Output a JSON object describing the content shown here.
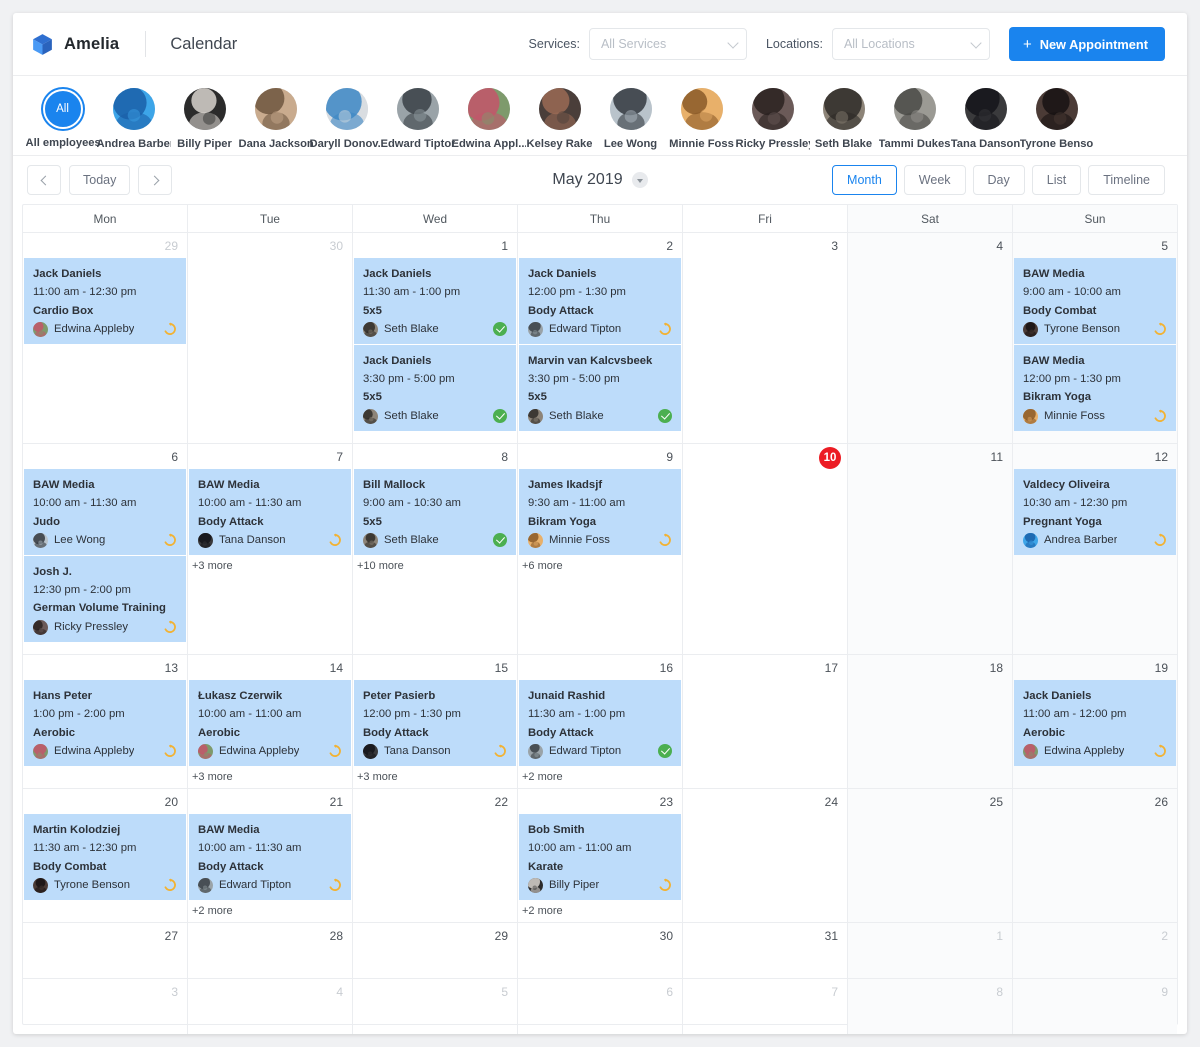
{
  "header": {
    "brand": "Amelia",
    "page_title": "Calendar",
    "services_label": "Services:",
    "services_value": "All Services",
    "locations_label": "Locations:",
    "locations_value": "All Locations",
    "new_appointment": "New Appointment",
    "plus_icon": "plus-icon"
  },
  "employees": [
    {
      "name": "All employees",
      "short": "All",
      "selected": true
    },
    {
      "name": "Andrea Barber",
      "c1": "#3da5e8",
      "c2": "#1a5fa8"
    },
    {
      "name": "Billy Piper",
      "c1": "#2b2b2b",
      "c2": "#d8d4ce"
    },
    {
      "name": "Dana Jackson",
      "c1": "#c9ab8e",
      "c2": "#6e5640"
    },
    {
      "name": "Daryll Donov...",
      "c1": "#d9dde1",
      "c2": "#3c87c4"
    },
    {
      "name": "Edward Tipton",
      "c1": "#9aa3a8",
      "c2": "#3a4146"
    },
    {
      "name": "Edwina Appl...",
      "c1": "#7e9a6c",
      "c2": "#c3556a"
    },
    {
      "name": "Kelsey Rake",
      "c1": "#4a3e3a",
      "c2": "#9a6a55"
    },
    {
      "name": "Lee Wong",
      "c1": "#b9c3cb",
      "c2": "#32383f"
    },
    {
      "name": "Minnie Foss",
      "c1": "#e8b06a",
      "c2": "#8a5a28"
    },
    {
      "name": "Ricky Pressley",
      "c1": "#6b5a58",
      "c2": "#2a2220"
    },
    {
      "name": "Seth Blake",
      "c1": "#8d8478",
      "c2": "#2f2c28"
    },
    {
      "name": "Tammi Dukes",
      "c1": "#9b9a94",
      "c2": "#4a4a46"
    },
    {
      "name": "Tana Danson",
      "c1": "#3a3a3c",
      "c2": "#15151a"
    },
    {
      "name": "Tyrone Benson",
      "c1": "#4b3b36",
      "c2": "#171313"
    }
  ],
  "toolbar": {
    "prev_icon": "chevron-left-icon",
    "next_icon": "chevron-right-icon",
    "today": "Today",
    "title": "May 2019",
    "title_caret_icon": "chevron-down-icon",
    "views": [
      {
        "label": "Month",
        "active": true
      },
      {
        "label": "Week",
        "active": false
      },
      {
        "label": "Day",
        "active": false
      },
      {
        "label": "List",
        "active": false
      },
      {
        "label": "Timeline",
        "active": false
      }
    ]
  },
  "calendar": {
    "day_headers": [
      "Mon",
      "Tue",
      "Wed",
      "Thu",
      "Fri",
      "Sat",
      "Sun"
    ],
    "more_label_prefix": "+",
    "more_label_suffix": " more",
    "weeks": [
      {
        "days": [
          {
            "num": "29",
            "muted": true,
            "events": [
              {
                "client": "Jack Daniels",
                "time": "11:00 am - 12:30 pm",
                "service": "Cardio Box",
                "employee": "Edwina Appleby",
                "status": "pending",
                "c1": "#7e9a6c",
                "c2": "#c3556a"
              }
            ]
          },
          {
            "num": "30",
            "muted": true,
            "events": []
          },
          {
            "num": "1",
            "events": [
              {
                "client": "Jack Daniels",
                "time": "11:30 am - 1:00 pm",
                "service": "5x5",
                "employee": "Seth Blake",
                "status": "approved",
                "c1": "#8d8478",
                "c2": "#2f2c28"
              },
              {
                "client": "Jack Daniels",
                "time": "3:30 pm - 5:00 pm",
                "service": "5x5",
                "employee": "Seth Blake",
                "status": "approved",
                "c1": "#8d8478",
                "c2": "#2f2c28"
              }
            ]
          },
          {
            "num": "2",
            "events": [
              {
                "client": "Jack Daniels",
                "time": "12:00 pm - 1:30 pm",
                "service": "Body Attack",
                "employee": "Edward Tipton",
                "status": "pending",
                "c1": "#9aa3a8",
                "c2": "#3a4146"
              },
              {
                "client": "Marvin van Kalcvsbeek",
                "time": "3:30 pm - 5:00 pm",
                "service": "5x5",
                "employee": "Seth Blake",
                "status": "approved",
                "c1": "#8d8478",
                "c2": "#2f2c28"
              }
            ]
          },
          {
            "num": "3",
            "events": []
          },
          {
            "num": "4",
            "weekend": true,
            "events": []
          },
          {
            "num": "5",
            "weekend": true,
            "events": [
              {
                "client": "BAW Media",
                "time": "9:00 am - 10:00 am",
                "service": "Body Combat",
                "employee": "Tyrone Benson",
                "status": "pending",
                "c1": "#4b3b36",
                "c2": "#171313"
              },
              {
                "client": "BAW Media",
                "time": "12:00 pm - 1:30 pm",
                "service": "Bikram Yoga",
                "employee": "Minnie Foss",
                "status": "pending",
                "c1": "#e8b06a",
                "c2": "#8a5a28"
              }
            ]
          }
        ]
      },
      {
        "days": [
          {
            "num": "6",
            "events": [
              {
                "client": "BAW Media",
                "time": "10:00 am - 11:30 am",
                "service": "Judo",
                "employee": "Lee Wong",
                "status": "pending",
                "c1": "#b9c3cb",
                "c2": "#32383f"
              },
              {
                "client": "Josh J.",
                "time": "12:30 pm - 2:00 pm",
                "service": "German Volume Training",
                "employee": "Ricky Pressley",
                "status": "pending",
                "c1": "#6b5a58",
                "c2": "#2a2220"
              }
            ]
          },
          {
            "num": "7",
            "more": "+3 more",
            "events": [
              {
                "client": "BAW Media",
                "time": "10:00 am - 11:30 am",
                "service": "Body Attack",
                "employee": "Tana Danson",
                "status": "pending",
                "c1": "#3a3a3c",
                "c2": "#15151a"
              }
            ]
          },
          {
            "num": "8",
            "more": "+10 more",
            "events": [
              {
                "client": "Bill Mallock",
                "time": "9:00 am - 10:30 am",
                "service": "5x5",
                "employee": "Seth Blake",
                "status": "approved",
                "c1": "#8d8478",
                "c2": "#2f2c28"
              }
            ]
          },
          {
            "num": "9",
            "more": "+6 more",
            "events": [
              {
                "client": "James Ikadsjf",
                "time": "9:30 am - 11:00 am",
                "service": "Bikram Yoga",
                "employee": "Minnie Foss",
                "status": "pending",
                "c1": "#e8b06a",
                "c2": "#8a5a28"
              }
            ]
          },
          {
            "num": "10",
            "today": true,
            "events": []
          },
          {
            "num": "11",
            "weekend": true,
            "events": []
          },
          {
            "num": "12",
            "weekend": true,
            "events": [
              {
                "client": "Valdecy Oliveira",
                "time": "10:30 am - 12:30 pm",
                "service": "Pregnant Yoga",
                "employee": "Andrea Barber",
                "status": "pending",
                "c1": "#3da5e8",
                "c2": "#1a5fa8"
              }
            ]
          }
        ]
      },
      {
        "days": [
          {
            "num": "13",
            "events": [
              {
                "client": "Hans Peter",
                "time": "1:00 pm - 2:00 pm",
                "service": "Aerobic",
                "employee": "Edwina Appleby",
                "status": "pending",
                "c1": "#7e9a6c",
                "c2": "#c3556a"
              }
            ]
          },
          {
            "num": "14",
            "more": "+3 more",
            "events": [
              {
                "client": "Łukasz Czerwik",
                "time": "10:00 am - 11:00 am",
                "service": "Aerobic",
                "employee": "Edwina Appleby",
                "status": "pending",
                "c1": "#7e9a6c",
                "c2": "#c3556a"
              }
            ]
          },
          {
            "num": "15",
            "more": "+3 more",
            "events": [
              {
                "client": "Peter Pasierb",
                "time": "12:00 pm - 1:30 pm",
                "service": "Body Attack",
                "employee": "Tana Danson",
                "status": "pending",
                "c1": "#3a3a3c",
                "c2": "#15151a"
              }
            ]
          },
          {
            "num": "16",
            "more": "+2 more",
            "events": [
              {
                "client": "Junaid Rashid",
                "time": "11:30 am - 1:00 pm",
                "service": "Body Attack",
                "employee": "Edward Tipton",
                "status": "approved",
                "c1": "#9aa3a8",
                "c2": "#3a4146"
              }
            ]
          },
          {
            "num": "17",
            "events": []
          },
          {
            "num": "18",
            "weekend": true,
            "events": []
          },
          {
            "num": "19",
            "weekend": true,
            "events": [
              {
                "client": "Jack Daniels",
                "time": "11:00 am - 12:00 pm",
                "service": "Aerobic",
                "employee": "Edwina Appleby",
                "status": "pending",
                "c1": "#7e9a6c",
                "c2": "#c3556a"
              }
            ]
          }
        ]
      },
      {
        "days": [
          {
            "num": "20",
            "events": [
              {
                "client": "Martin Kolodziej",
                "time": "11:30 am - 12:30 pm",
                "service": "Body Combat",
                "employee": "Tyrone Benson",
                "status": "pending",
                "c1": "#4b3b36",
                "c2": "#171313"
              }
            ]
          },
          {
            "num": "21",
            "more": "+2 more",
            "events": [
              {
                "client": "BAW Media",
                "time": "10:00 am - 11:30 am",
                "service": "Body Attack",
                "employee": "Edward Tipton",
                "status": "pending",
                "c1": "#9aa3a8",
                "c2": "#3a4146"
              }
            ]
          },
          {
            "num": "22",
            "events": []
          },
          {
            "num": "23",
            "more": "+2 more",
            "events": [
              {
                "client": "Bob Smith",
                "time": "10:00 am - 11:00 am",
                "service": "Karate",
                "employee": "Billy Piper",
                "status": "pending",
                "c1": "#2b2b2b",
                "c2": "#d8d4ce"
              }
            ]
          },
          {
            "num": "24",
            "events": []
          },
          {
            "num": "25",
            "weekend": true,
            "events": []
          },
          {
            "num": "26",
            "weekend": true,
            "events": []
          }
        ]
      },
      {
        "days": [
          {
            "num": "27",
            "events": []
          },
          {
            "num": "28",
            "events": []
          },
          {
            "num": "29",
            "events": []
          },
          {
            "num": "30",
            "events": []
          },
          {
            "num": "31",
            "events": []
          },
          {
            "num": "1",
            "muted": true,
            "weekend": true,
            "events": []
          },
          {
            "num": "2",
            "muted": true,
            "weekend": true,
            "events": []
          }
        ]
      },
      {
        "days": [
          {
            "num": "3",
            "muted": true,
            "events": []
          },
          {
            "num": "4",
            "muted": true,
            "events": []
          },
          {
            "num": "5",
            "muted": true,
            "events": []
          },
          {
            "num": "6",
            "muted": true,
            "events": []
          },
          {
            "num": "7",
            "muted": true,
            "events": []
          },
          {
            "num": "8",
            "muted": true,
            "weekend": true,
            "events": []
          },
          {
            "num": "9",
            "muted": true,
            "weekend": true,
            "events": []
          }
        ]
      }
    ]
  }
}
